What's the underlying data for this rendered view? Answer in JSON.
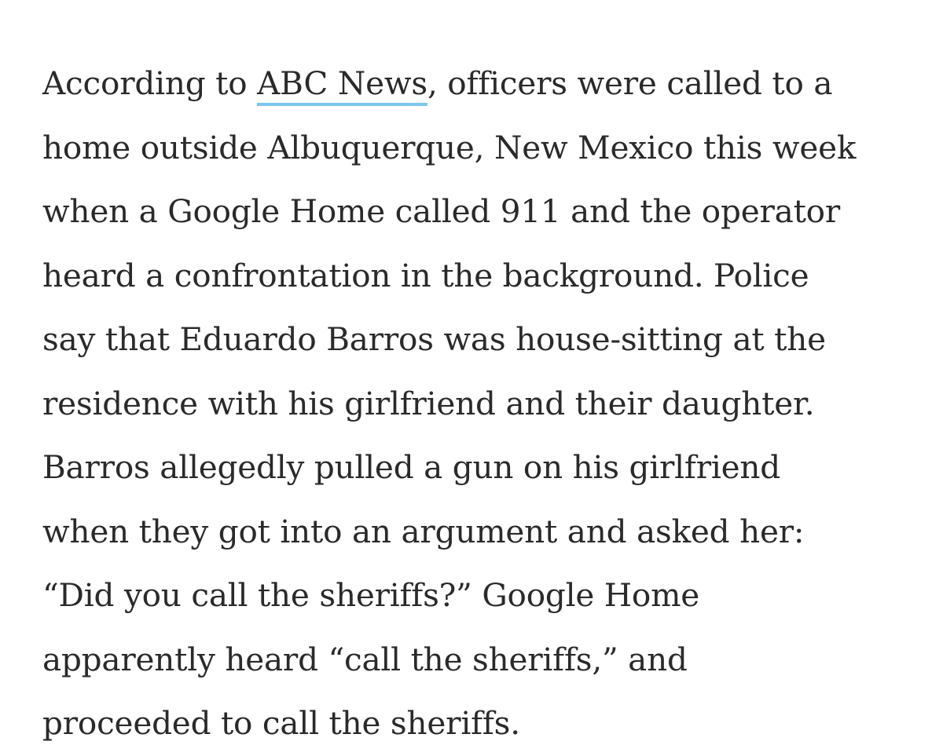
{
  "article": {
    "paragraph": {
      "line1_before_link": "According to ",
      "link_text": "ABC News",
      "line1_after_link": ", officers were called to a",
      "line2": "home outside Albuquerque, New Mexico this week",
      "line3": "when a Google Home called 911 and the operator",
      "line4": "heard a confrontation in the background. Police",
      "line5": "say that Eduardo Barros was house-sitting at the",
      "line6": "residence with his girlfriend and their daughter.",
      "line7": "Barros allegedly pulled a gun on his girlfriend",
      "line8": "when they got into an argument and asked her:",
      "line9": "“Did you call the sheriffs?” Google Home",
      "line10": "apparently heard “call the sheriffs,” and",
      "line11": "proceeded to call the sheriffs."
    },
    "link_underline_color": "#7cc6ee",
    "text_color": "#2a2a2a"
  }
}
